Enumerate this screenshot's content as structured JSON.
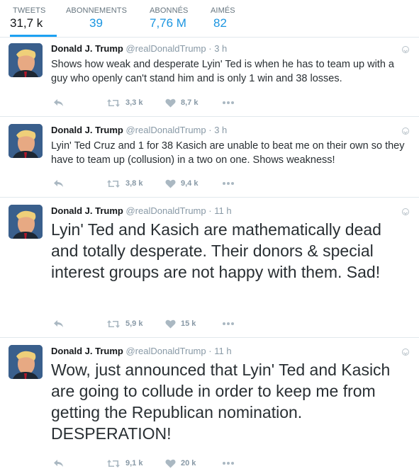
{
  "stats": [
    {
      "label": "TWEETS",
      "value": "31,7 k",
      "active": true
    },
    {
      "label": "ABONNEMENTS",
      "value": "39"
    },
    {
      "label": "ABONNÉS",
      "value": "7,76 M"
    },
    {
      "label": "AIMÉS",
      "value": "82"
    }
  ],
  "tweets": [
    {
      "fullname": "Donald J. Trump",
      "username": "@realDonaldTrump",
      "sep": "·",
      "time": "3 h",
      "text": "Shows how weak and desperate Lyin' Ted is when he has to team up with a guy who openly can't stand him and is only 1 win and 38 losses.",
      "retweets": "3,3 k",
      "likes": "8,7 k"
    },
    {
      "fullname": "Donald J. Trump",
      "username": "@realDonaldTrump",
      "sep": "·",
      "time": "3 h",
      "text": "Lyin' Ted Cruz and 1 for 38 Kasich are unable to beat me on their own so they have to team up (collusion) in a two on one. Shows weakness!",
      "retweets": "3,8 k",
      "likes": "9,4 k"
    },
    {
      "fullname": "Donald J. Trump",
      "username": "@realDonaldTrump",
      "sep": "·",
      "time": "11 h",
      "text": "Lyin' Ted and Kasich are mathematically dead and totally desperate. Their donors & special interest groups are not happy with them. Sad!",
      "retweets": "5,9 k",
      "likes": "15 k"
    },
    {
      "fullname": "Donald J. Trump",
      "username": "@realDonaldTrump",
      "sep": "·",
      "time": "11 h",
      "text": "Wow, just announced that Lyin' Ted and Kasich are going to collude in order to keep me from getting the Republican nomination. DESPERATION!",
      "retweets": "9,1 k",
      "likes": "20 k"
    }
  ],
  "icons": {
    "reply": "reply-icon",
    "retweet": "retweet-icon",
    "like": "heart-icon",
    "more": "more-dots-icon",
    "caret": "caret-down-icon"
  },
  "colors": {
    "accent": "#1da1f2",
    "link": "#1b95e0",
    "muted": "#8899a6",
    "divider": "#e1e8ed"
  }
}
